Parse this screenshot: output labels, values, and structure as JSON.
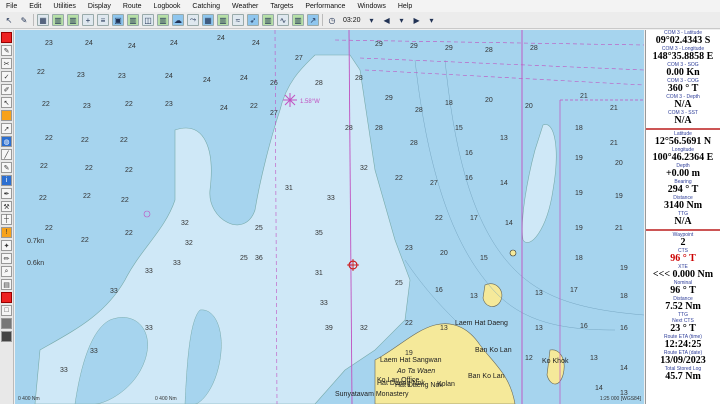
{
  "menu": [
    "File",
    "Edit",
    "Utilities",
    "Display",
    "Route",
    "Logbook",
    "Catching",
    "Weather",
    "Targets",
    "Performance",
    "Windows",
    "Help"
  ],
  "toolbar": {
    "time": "03:20"
  },
  "chart": {
    "position_label": "1.58°W",
    "places": [
      {
        "label": "Laem Hat Sangwan"
      },
      {
        "label": "Ao Ta Waen"
      },
      {
        "label": "Hat Daeng Nok"
      },
      {
        "label": "Ban Ko Lan"
      },
      {
        "label": "Ko Lan Office"
      },
      {
        "label": "Hat Daeng Nok"
      },
      {
        "label": "Ban Ko Lan"
      },
      {
        "label": "Sunyatavam Monastery"
      },
      {
        "label": "Laem Hat Daeng"
      },
      {
        "label": "Ko Khok"
      },
      {
        "label": "Kolan"
      }
    ],
    "scale_left": "0 400 Nm",
    "scale_mid": "0 400 Nm",
    "datum": "1:25 000 [WGS84]",
    "depth_labels": [
      "0.7kn",
      "0.6kn"
    ]
  },
  "panel": {
    "items": [
      {
        "label": "COM 3 - Latitude",
        "value": "09°02.4343 S"
      },
      {
        "label": "COM 3 - Longitude",
        "value": "148°35.8858 E"
      },
      {
        "label": "COM 3 - SOG",
        "value": "0.00 Kn"
      },
      {
        "label": "COM 3 - COG",
        "value": "360 ° T"
      },
      {
        "label": "COM 3 - Depth",
        "value": "N/A"
      },
      {
        "label": "COM 3 - SST",
        "value": "N/A"
      },
      {
        "label": "Latitude",
        "value": "12°56.5691 N"
      },
      {
        "label": "Longitude",
        "value": "100°46.2364 E"
      },
      {
        "label": "Depth",
        "value": "+0.00 m"
      },
      {
        "label": "Bearing",
        "value": "294 ° T"
      },
      {
        "label": "Distance",
        "value": "3140 Nm"
      },
      {
        "label": "TTG",
        "value": "N/A"
      },
      {
        "label": "Waypoint",
        "value": "2"
      },
      {
        "label": "CTS",
        "value": "96 ° T",
        "red": true
      },
      {
        "label": "XTE",
        "value": "<<< 0.000 Nm"
      },
      {
        "label": "Nominal",
        "value": "96 ° T"
      },
      {
        "label": "Distance",
        "value": "7.52 Nm"
      },
      {
        "label": "TTG",
        "value": ""
      },
      {
        "label": "Next CTS",
        "value": "23 ° T"
      },
      {
        "label": "Route ETA (time)",
        "value": "12:24:25"
      },
      {
        "label": "Route ETA (date)",
        "value": "13/09/2023"
      },
      {
        "label": "Total Stored Log",
        "value": "45.7 Nm"
      }
    ]
  },
  "colors": {
    "water": "#a6d4ee",
    "shallow": "#cfe8f7",
    "land": "#f5e99a",
    "route": "#c050c0"
  }
}
